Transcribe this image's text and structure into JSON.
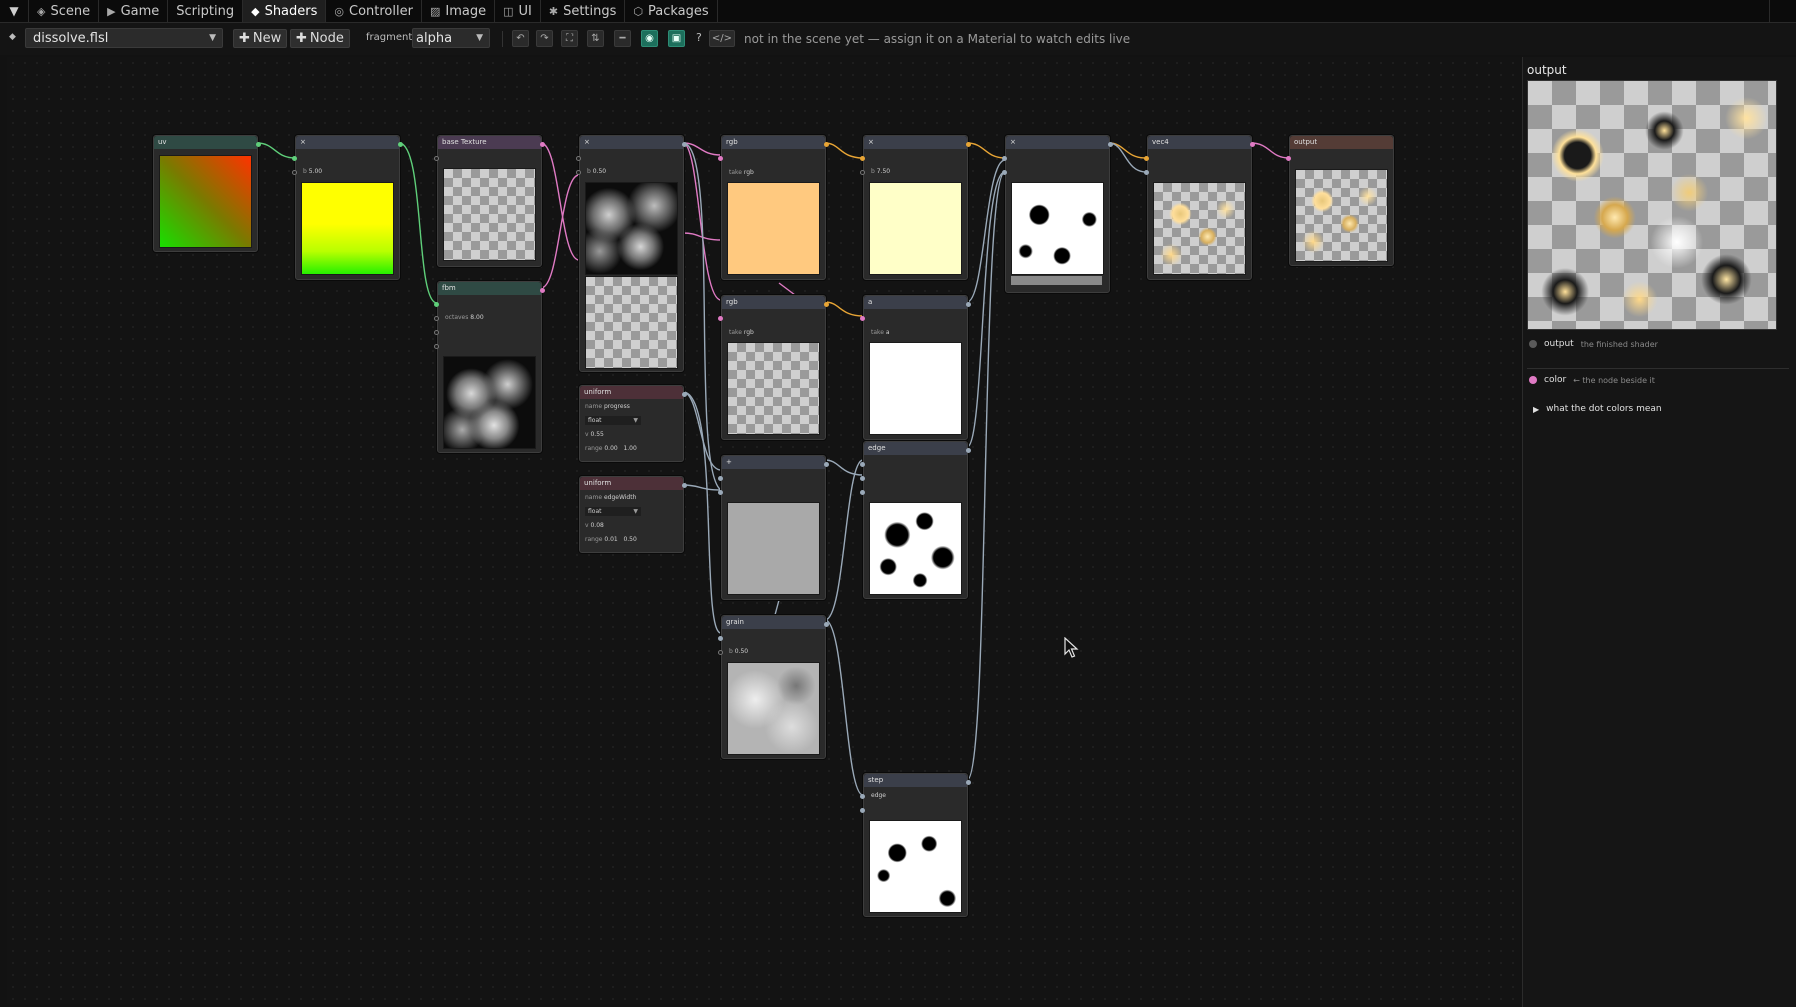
{
  "tabs": {
    "items": [
      {
        "label": "Scene",
        "icon": "scene-icon"
      },
      {
        "label": "Game",
        "icon": "play-icon"
      },
      {
        "label": "Scripting",
        "icon": ""
      },
      {
        "label": "Shaders",
        "icon": "diamond-icon"
      },
      {
        "label": "Controller",
        "icon": "controller-icon"
      },
      {
        "label": "Image",
        "icon": "image-icon"
      },
      {
        "label": "UI",
        "icon": "ui-icon"
      },
      {
        "label": "Settings",
        "icon": "gear-icon"
      },
      {
        "label": "Packages",
        "icon": "package-icon"
      }
    ],
    "active": "Shaders"
  },
  "toolbar": {
    "file": "dissolve.flsl",
    "new_label": "New",
    "node_label": "Node",
    "fragment_label": "fragment",
    "blend_mode": "alpha",
    "help_label": "?",
    "code_label": "</>",
    "status": "not in the scene yet — assign it on a Material to watch edits live"
  },
  "nodes": {
    "uv": {
      "title": "uv"
    },
    "mul1": {
      "title": "×",
      "field": "5.00"
    },
    "base_texture": {
      "title": "base Texture"
    },
    "fbm": {
      "title": "fbm",
      "field": "8.00"
    },
    "mul2": {
      "title": "×",
      "field": "0.50"
    },
    "rgb1": {
      "title": "rgb",
      "field_label": "rgb"
    },
    "mul3": {
      "title": "×",
      "field": "7.50"
    },
    "mul4": {
      "title": "×"
    },
    "vec4": {
      "title": "vec4"
    },
    "output": {
      "title": "output"
    },
    "rgb2": {
      "title": "rgb",
      "field_label": "rgb"
    },
    "a": {
      "title": "a",
      "field_label": "a"
    },
    "uniform1": {
      "title": "uniform",
      "name": "progress",
      "type": "float",
      "value": "0.55",
      "range_min": "0.00",
      "range_max": "1.00"
    },
    "uniform2": {
      "title": "uniform",
      "name": "edgeWidth",
      "type": "float",
      "value": "0.08",
      "range_min": "0.01",
      "range_max": "0.50"
    },
    "add": {
      "title": "+"
    },
    "edge": {
      "title": "edge"
    },
    "grain": {
      "title": "grain",
      "field": "0.50"
    },
    "step": {
      "title": "step",
      "field_label": "edge"
    }
  },
  "panel": {
    "title": "output",
    "legend": [
      {
        "name": "output",
        "desc": "the finished shader",
        "color": "#5a5a5a"
      },
      {
        "name": "color",
        "desc": "← the node beside it",
        "color": "#e07ac4"
      }
    ],
    "disclosure": "what the dot colors mean"
  },
  "colors": {
    "accent": "#1d6f5c",
    "wire_green": "#5fcf7a",
    "wire_pink": "#e07ac4",
    "wire_orange": "#e8a535",
    "wire_gray": "#9aa9b8"
  }
}
